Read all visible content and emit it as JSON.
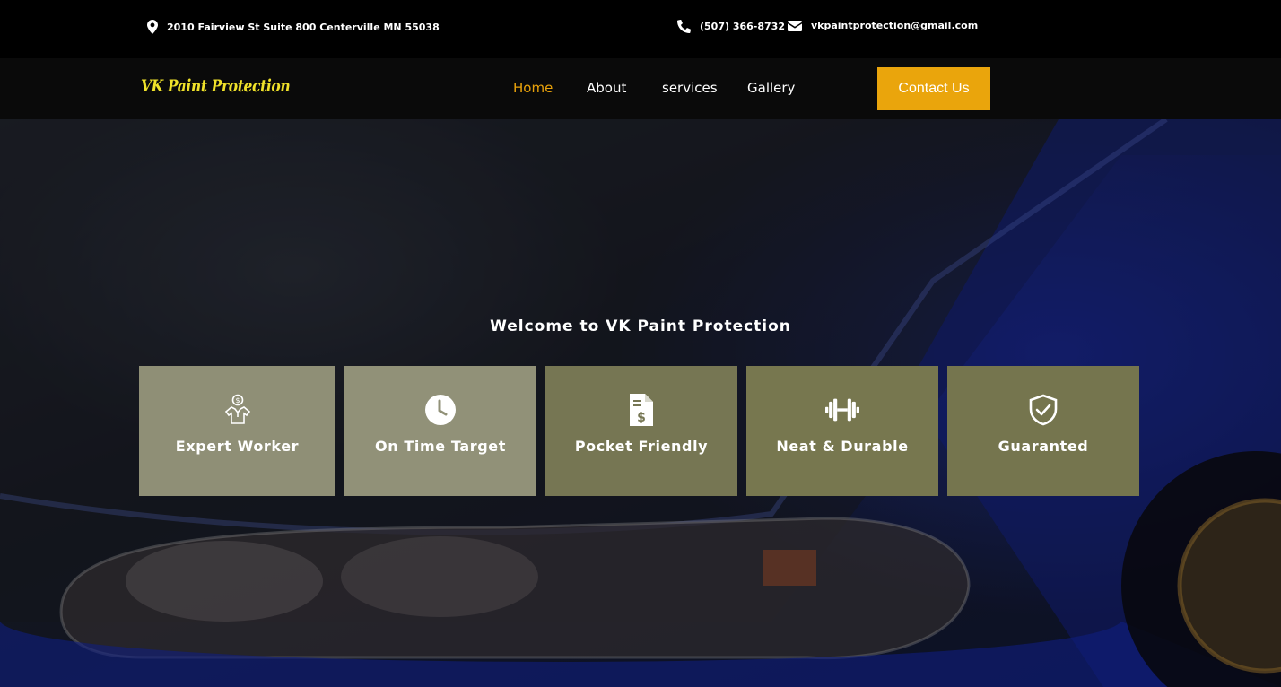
{
  "topbar": {
    "address": "2010 Fairview St Suite 800 Centerville MN 55038",
    "phone": "(507) 366-8732",
    "email": "vkpaintprotection@gmail.com"
  },
  "nav": {
    "logo": "VK Paint Protection",
    "links": [
      "Home",
      "About",
      "services",
      "Gallery"
    ],
    "active": "Home",
    "contact_label": "Contact Us"
  },
  "hero": {
    "title": "Welcome to VK Paint Protection",
    "features": [
      {
        "label": "Expert Worker",
        "icon": "worker-icon"
      },
      {
        "label": "On Time Target",
        "icon": "clock-icon"
      },
      {
        "label": "Pocket Friendly",
        "icon": "invoice-icon"
      },
      {
        "label": "Neat & Durable",
        "icon": "dumbbell-icon"
      },
      {
        "label": "Guaranted",
        "icon": "shield-check-icon"
      }
    ]
  },
  "colors": {
    "accent": "#eaa50c",
    "active_link": "#e9a20a",
    "logo": "#f0e22a"
  }
}
